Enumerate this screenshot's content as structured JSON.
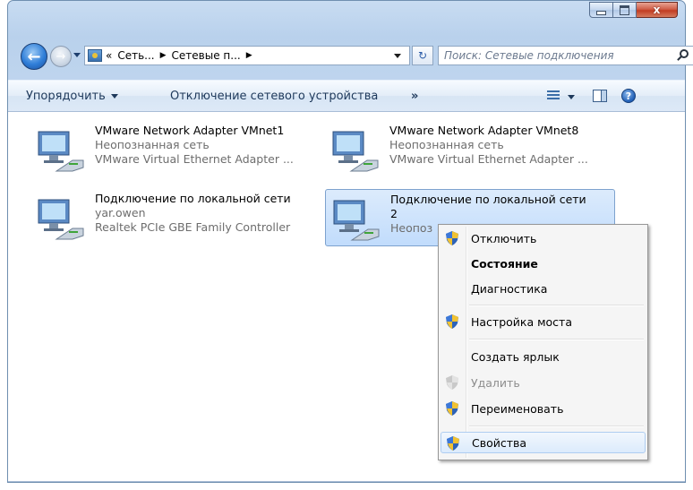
{
  "titlebar": {
    "minimize_icon": "minimize-icon",
    "maximize_icon": "maximize-icon",
    "close_icon": "close-icon",
    "close_glyph": "x"
  },
  "nav": {
    "back_glyph": "←",
    "forward_glyph": "→",
    "address_prefix": "«",
    "crumbs": [
      "Сеть...",
      "Сетевые п..."
    ],
    "separator": "▶",
    "refresh_glyph": "↻",
    "search_placeholder": "Поиск: Сетевые подключения"
  },
  "toolbar": {
    "organize": "Упорядочить",
    "disable_device": "Отключение сетевого устройства",
    "more": "»",
    "help_glyph": "?"
  },
  "items": [
    {
      "name": "VMware Network Adapter VMnet1",
      "status": "Неопознанная сеть",
      "device": "VMware Virtual Ethernet Adapter ..."
    },
    {
      "name": "VMware Network Adapter VMnet8",
      "status": "Неопознанная сеть",
      "device": "VMware Virtual Ethernet Adapter ..."
    },
    {
      "name": "Подключение по локальной сети",
      "status": "yar.owen",
      "device": "Realtek PCIe GBE Family Controller"
    },
    {
      "name": "Подключение по локальной сети",
      "name_line2": "2",
      "status": "Неопоз",
      "device": ""
    }
  ],
  "context_menu": {
    "items": [
      {
        "label": "Отключить",
        "shield": true
      },
      {
        "label": "Состояние",
        "bold": true
      },
      {
        "label": "Диагностика"
      },
      {
        "label": "Настройка моста",
        "shield": true
      },
      {
        "label": "Создать ярлык"
      },
      {
        "label": "Удалить",
        "shield": true,
        "disabled": true
      },
      {
        "label": "Переименовать",
        "shield": true
      },
      {
        "label": "Свойства",
        "shield": true,
        "highlighted": true
      }
    ]
  },
  "colors": {
    "window_frame": "#b9d1ec",
    "selection": "#c1dcfc",
    "toolbar_text": "#1e395b",
    "subtext": "#6d6d6d"
  }
}
